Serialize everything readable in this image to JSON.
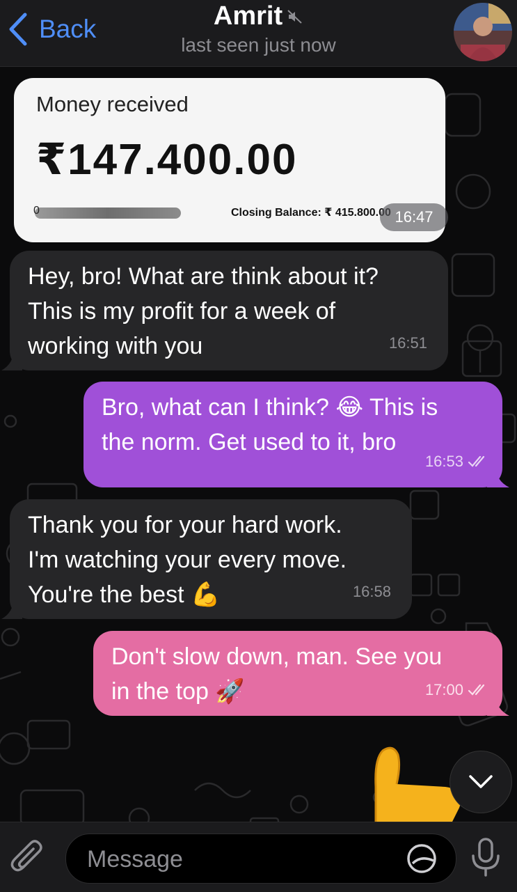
{
  "header": {
    "back_label": "Back",
    "contact_name": "Amrit",
    "status": "last seen just now",
    "muted_icon": "speaker-muted-icon",
    "avatar_icon": "avatar"
  },
  "messages": [
    {
      "kind": "money-card",
      "label": "Money received",
      "amount": "₹147.400.00",
      "account_prefix": "0",
      "closing_balance": "Closing Balance: ₹ 415.800.00",
      "time": "16:47"
    },
    {
      "kind": "incoming",
      "lines": [
        "Hey, bro! What are think about it?",
        "This is my profit for a week of",
        "working with you"
      ],
      "time": "16:51"
    },
    {
      "kind": "outgoing",
      "lines": [
        "Bro, what can I think? 😂 This is",
        "the norm. Get used to it, bro"
      ],
      "time": "16:53",
      "status_icon": "double-check-icon",
      "color": "#a050d8"
    },
    {
      "kind": "incoming",
      "lines": [
        "Thank you for your hard work.",
        "I'm watching your every move.",
        "You're the best 💪"
      ],
      "time": "16:58"
    },
    {
      "kind": "outgoing",
      "lines": [
        "Don't slow down, man. See you",
        "in the top 🚀"
      ],
      "time": "17:00",
      "status_icon": "double-check-icon",
      "color": "#e46da3"
    }
  ],
  "input": {
    "placeholder": "Message"
  },
  "colors": {
    "accent": "#4f8ef7",
    "header_bg": "#1b1b1d",
    "incoming_bubble": "#262628"
  }
}
